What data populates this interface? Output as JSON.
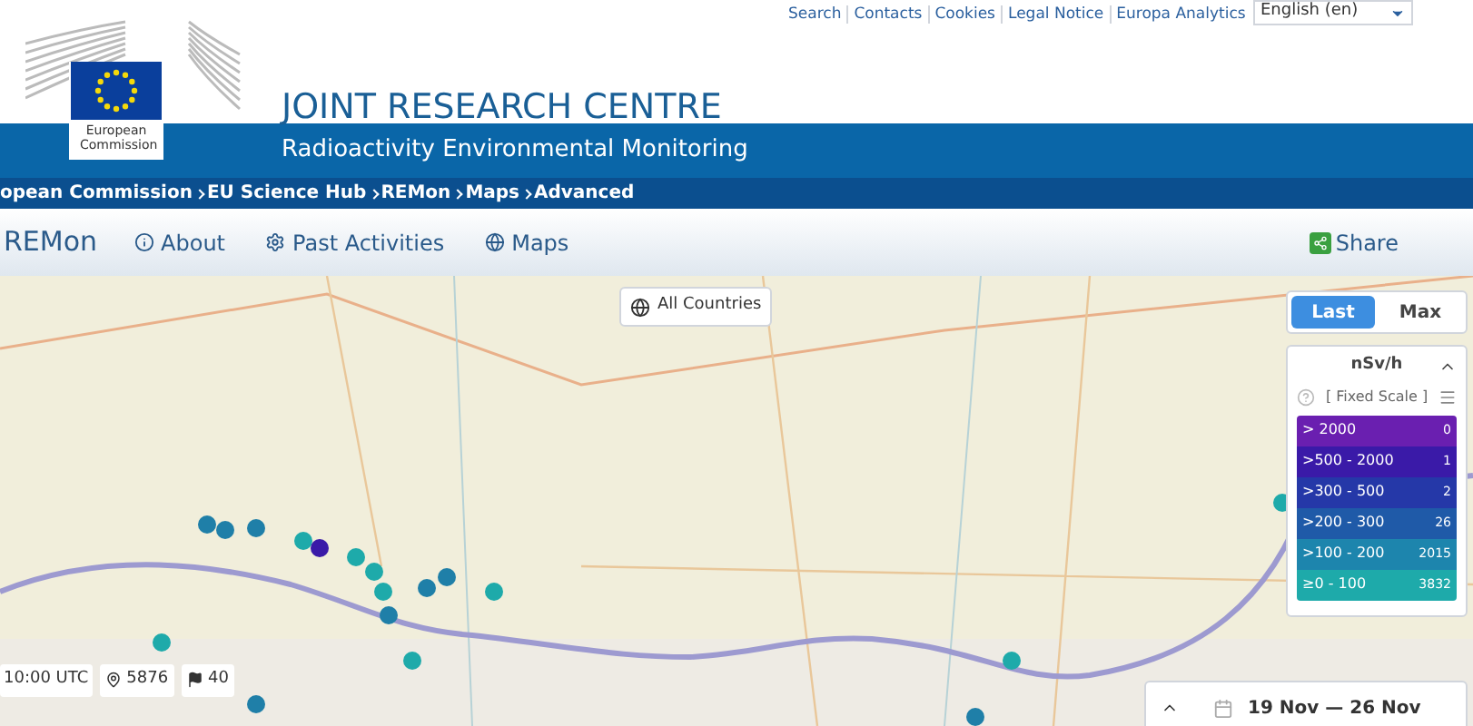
{
  "top_links": [
    "Search",
    "Contacts",
    "Cookies",
    "Legal Notice",
    "Europa Analytics"
  ],
  "language_select": {
    "value": "English (en)"
  },
  "logo": {
    "caption": "European Commission"
  },
  "site_title": "JOINT RESEARCH CENTRE",
  "site_subtitle": "Radioactivity Environmental Monitoring",
  "breadcrumb": [
    "opean Commission",
    "EU Science Hub",
    "REMon",
    "Maps",
    "Advanced"
  ],
  "nav": {
    "brand": "REMon",
    "items": [
      {
        "label": "About"
      },
      {
        "label": "Past Activities"
      },
      {
        "label": "Maps"
      }
    ],
    "share": "Share"
  },
  "map": {
    "country_button": "All Countries",
    "mode_toggle": [
      {
        "label": "Last",
        "selected": true
      },
      {
        "label": "Max",
        "selected": false
      }
    ],
    "legend": {
      "unit": "nSv/h",
      "scale": "[ Fixed Scale ]",
      "rows": [
        {
          "label": "> 2000",
          "count": "0",
          "color": "#6a1fb0"
        },
        {
          "label": ">500 - 2000",
          "count": "1",
          "color": "#3a1aa8"
        },
        {
          "label": ">300 - 500",
          "count": "2",
          "color": "#2538a8"
        },
        {
          "label": ">200 - 300",
          "count": "26",
          "color": "#1f5aa8"
        },
        {
          "label": ">100 - 200",
          "count": "2015",
          "color": "#1d85ad"
        },
        {
          "label": "≥0 - 100",
          "count": "3832",
          "color": "#1eaaaa"
        }
      ]
    },
    "markers": [
      {
        "color": "#1f7fa8"
      },
      {
        "color": "#1f7fa8"
      },
      {
        "color": "#1f7fa8"
      },
      {
        "color": "#1eaaaa"
      },
      {
        "color": "#3a1aa8"
      },
      {
        "color": "#1eaaaa"
      },
      {
        "color": "#1eaaaa"
      },
      {
        "color": "#1eaaaa"
      },
      {
        "color": "#1f7fa8"
      },
      {
        "color": "#1f7fa8"
      },
      {
        "color": "#1f7fa8"
      },
      {
        "color": "#1eaaaa"
      },
      {
        "color": "#1eaaaa"
      },
      {
        "color": "#1eaaaa"
      },
      {
        "color": "#1f7fa8"
      },
      {
        "color": "#1eaaaa"
      },
      {
        "color": "#1f7fa8"
      },
      {
        "color": "#1eaaaa"
      }
    ],
    "status": {
      "time": "10:00 UTC",
      "stations": "5876",
      "flags": "40"
    },
    "date_range": "19 Nov — 26 Nov"
  }
}
